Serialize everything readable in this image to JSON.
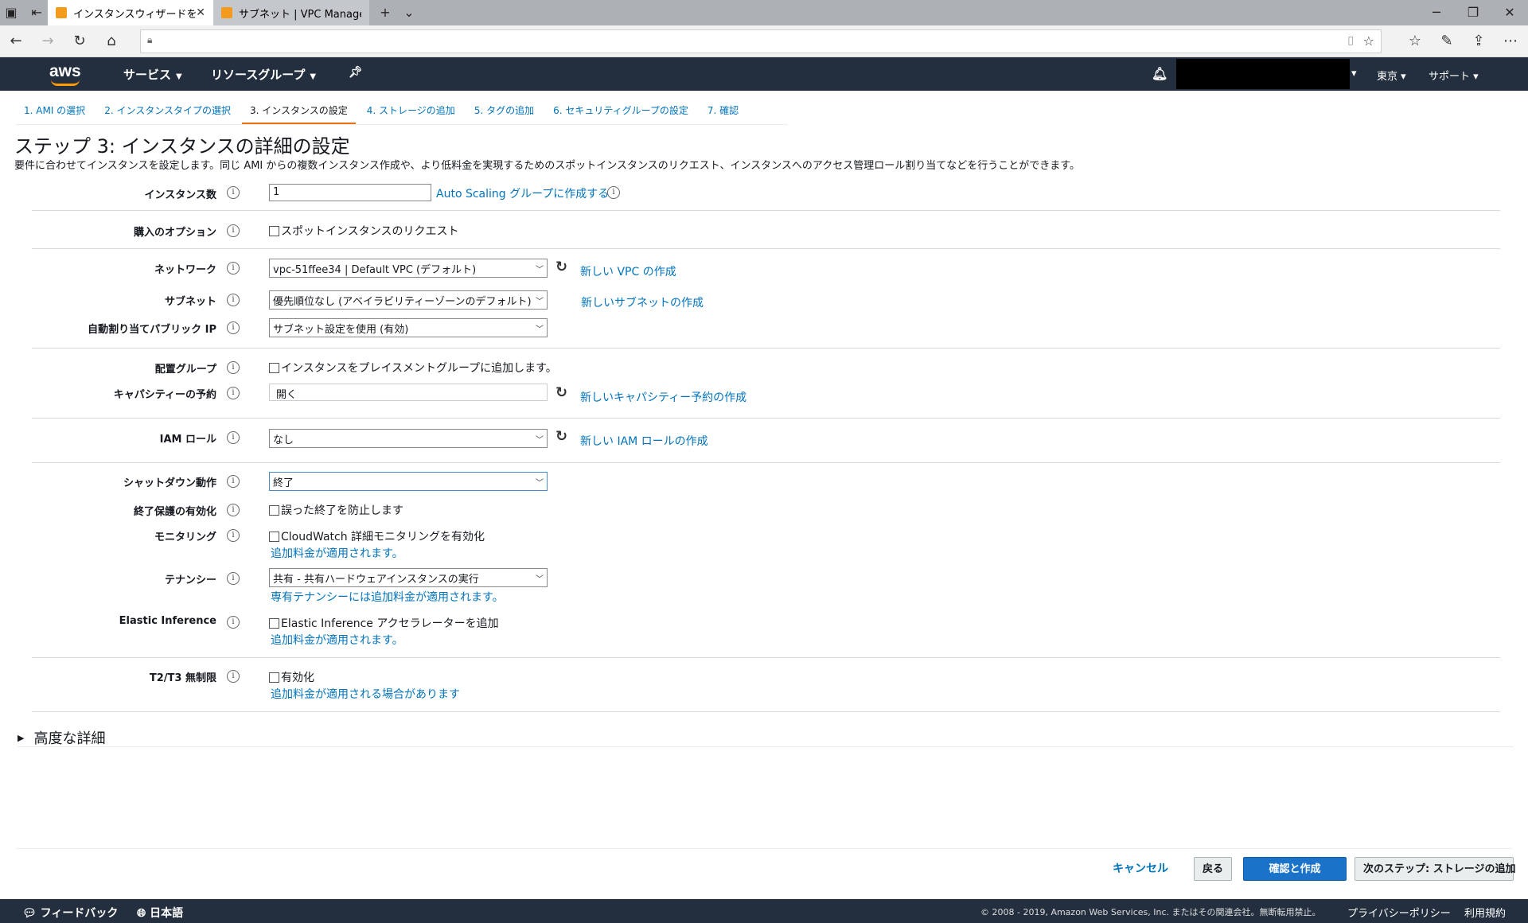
{
  "browser": {
    "tabs": [
      {
        "title": "インスタンスウィザードを起動",
        "close": "✕"
      },
      {
        "title": "サブネット | VPC Management",
        "close": ""
      }
    ],
    "new_tab": "+",
    "tab_list": "⌄",
    "window": {
      "minimize": "─",
      "restore": "❐",
      "close": "✕"
    },
    "url": ""
  },
  "header": {
    "logo": "aws",
    "services": "サービス",
    "resource_groups": "リソースグループ",
    "region": "東京",
    "support": "サポート"
  },
  "wizard_tabs": [
    "1. AMI の選択",
    "2. インスタンスタイプの選択",
    "3. インスタンスの設定",
    "4. ストレージの追加",
    "5. タグの追加",
    "6. セキュリティグループの設定",
    "7. 確認"
  ],
  "active_tab_index": 2,
  "page": {
    "title": "ステップ 3: インスタンスの詳細の設定",
    "description": "要件に合わせてインスタンスを設定します。同じ AMI からの複数インスタンス作成や、より低料金を実現するためのスポットインスタンスのリクエスト、インスタンスへのアクセス管理ロール割り当てなどを行うことができます。"
  },
  "form": {
    "instance_count": {
      "label": "インスタンス数",
      "value": "1",
      "link": "Auto Scaling グループに作成する"
    },
    "purchase_option": {
      "label": "購入のオプション",
      "checkbox": "スポットインスタンスのリクエスト"
    },
    "network": {
      "label": "ネットワーク",
      "value": "vpc-51ffee34 | Default VPC (デフォルト)",
      "link": "新しい VPC の作成"
    },
    "subnet": {
      "label": "サブネット",
      "value": "優先順位なし (アベイラビリティーゾーンのデフォルト)",
      "link": "新しいサブネットの作成"
    },
    "public_ip": {
      "label": "自動割り当てパブリック IP",
      "value": "サブネット設定を使用 (有効)"
    },
    "placement_group": {
      "label": "配置グループ",
      "checkbox": "インスタンスをプレイスメントグループに追加します。"
    },
    "capacity_reservation": {
      "label": "キャパシティーの予約",
      "value": "開く",
      "link": "新しいキャパシティー予約の作成"
    },
    "iam_role": {
      "label": "IAM ロール",
      "value": "なし",
      "link": "新しい IAM ロールの作成"
    },
    "shutdown": {
      "label": "シャットダウン動作",
      "value": "終了"
    },
    "termination_protection": {
      "label": "終了保護の有効化",
      "checkbox": "誤った終了を防止します"
    },
    "monitoring": {
      "label": "モニタリング",
      "checkbox": "CloudWatch 詳細モニタリングを有効化",
      "note": "追加料金が適用されます。"
    },
    "tenancy": {
      "label": "テナンシー",
      "value": "共有 - 共有ハードウェアインスタンスの実行",
      "note": "専有テナンシーには追加料金が適用されます。"
    },
    "elastic_inference": {
      "label": "Elastic Inference",
      "checkbox": "Elastic Inference アクセラレーターを追加",
      "note": "追加料金が適用されます。"
    },
    "t2t3_unlimited": {
      "label": "T2/T3 無制限",
      "checkbox": "有効化",
      "note": "追加料金が適用される場合があります"
    }
  },
  "advanced": "高度な詳細",
  "buttons": {
    "cancel": "キャンセル",
    "back": "戻る",
    "review": "確認と作成",
    "next": "次のステップ: ストレージの追加"
  },
  "footer": {
    "feedback": "フィードバック",
    "language": "日本語",
    "copyright": "© 2008 - 2019, Amazon Web Services, Inc. またはその関連会社。無断転用禁止。",
    "privacy": "プライバシーポリシー",
    "terms": "利用規約"
  },
  "colors": {
    "header_bg": "#232f3e",
    "link": "#0073bb",
    "primary_button": "#1a73c9",
    "active_tab_underline": "#ec7211"
  }
}
